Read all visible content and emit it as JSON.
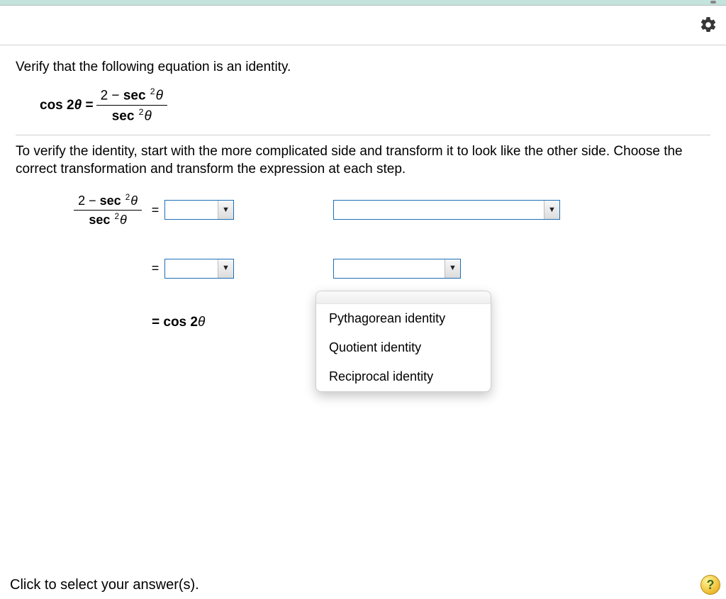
{
  "question": {
    "prompt": "Verify that the following equation is an identity.",
    "equation": {
      "lhs": "cos 2θ =",
      "numerator": "2 − sec ²θ",
      "denominator": "sec ²θ"
    }
  },
  "instructions": "To verify the identity, start with the more complicated side and transform it to look like the other side. Choose the correct transformation and transform the expression at each step.",
  "work": {
    "start": {
      "numerator": "2 − sec ²θ",
      "denominator": "sec ²θ"
    },
    "final": "= cos 2θ",
    "equals": "="
  },
  "dropdown": {
    "options": [
      "Pythagorean identity",
      "Quotient identity",
      "Reciprocal identity"
    ]
  },
  "footer": {
    "hint": "Click to select your answer(s).",
    "help": "?"
  }
}
